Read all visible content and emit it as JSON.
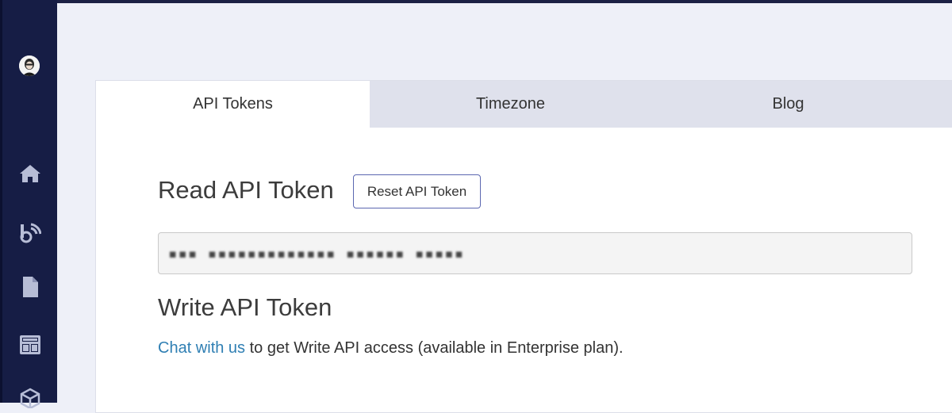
{
  "tabs": [
    {
      "label": "API Tokens",
      "active": true
    },
    {
      "label": "Timezone",
      "active": false
    },
    {
      "label": "Blog",
      "active": false
    }
  ],
  "read_section": {
    "title": "Read API Token",
    "reset_button_label": "Reset API Token",
    "token_value_masked": "▪▪▪ ▪▪▪▪▪▪▪▪▪▪▪▪▪ ▪▪▪▪▪▪ ▪▪▪▪▪"
  },
  "write_section": {
    "title": "Write API Token",
    "chat_link_label": "Chat with us",
    "info_text": " to get Write API access (available in Enterprise plan)."
  },
  "sidebar": {
    "icons": [
      "home-icon",
      "feed-icon",
      "document-icon",
      "dashboard-icon",
      "cube-icon"
    ]
  },
  "colors": {
    "sidebar_bg": "#161d45",
    "page_bg": "#eef0f8",
    "inactive_tab_bg": "#dfe1ec",
    "link": "#2f7fb3",
    "button_border": "#5b67b0"
  }
}
